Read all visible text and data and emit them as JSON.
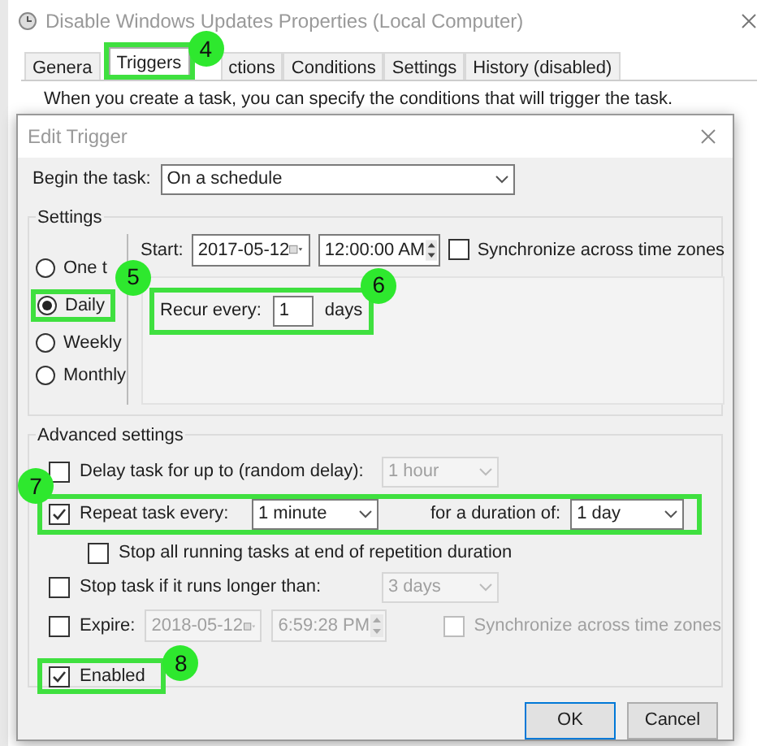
{
  "window": {
    "title": "Disable Windows Updates Properties (Local Computer)"
  },
  "tabs": [
    {
      "label": "Genera",
      "selected": false
    },
    {
      "label": "Triggers",
      "selected": true
    },
    {
      "label": "ctions",
      "selected": false
    },
    {
      "label": "Conditions",
      "selected": false
    },
    {
      "label": "Settings",
      "selected": false
    },
    {
      "label": "History (disabled)",
      "selected": false
    }
  ],
  "intro": "When you create a task, you can specify the conditions that will trigger the task.",
  "dialog": {
    "title": "Edit Trigger",
    "begin_label": "Begin the task:",
    "begin_value": "On a schedule",
    "settings": {
      "title": "Settings",
      "schedules": [
        {
          "label": "One t",
          "selected": false
        },
        {
          "label": "Daily",
          "selected": true
        },
        {
          "label": "Weekly",
          "selected": false
        },
        {
          "label": "Monthly",
          "selected": false
        }
      ],
      "start_label": "Start:",
      "start_date": "2017-05-12",
      "start_time": "12:00:00 AM",
      "sync": {
        "label": "Synchronize across time zones",
        "checked": false
      },
      "recur_label": "Recur every:",
      "recur_value": "1",
      "recur_unit": "days"
    },
    "advanced": {
      "title": "Advanced settings",
      "delay": {
        "label": "Delay task for up to (random delay):",
        "checked": false,
        "value": "1 hour"
      },
      "repeat": {
        "label": "Repeat task every:",
        "checked": true,
        "value": "1 minute",
        "duration_label": "for a duration of:",
        "duration_value": "1 day"
      },
      "stop_all": {
        "label": "Stop all running tasks at end of repetition duration",
        "checked": false
      },
      "stop_long": {
        "label": "Stop task if it runs longer than:",
        "checked": false,
        "value": "3 days"
      },
      "expire": {
        "label": "Expire:",
        "checked": false,
        "date": "2018-05-12",
        "time": "6:59:28 PM",
        "sync_label": "Synchronize across time zones"
      },
      "enabled": {
        "label": "Enabled",
        "checked": true
      }
    },
    "buttons": [
      "OK",
      "Cancel"
    ]
  },
  "callouts": [
    "4",
    "5",
    "6",
    "7",
    "8"
  ]
}
